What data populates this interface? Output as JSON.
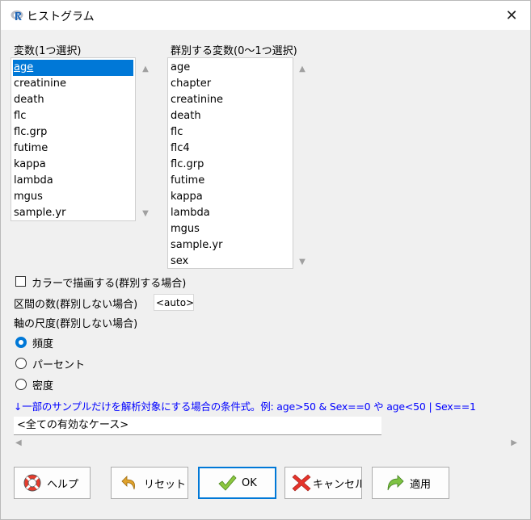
{
  "window": {
    "title": "ヒストグラム",
    "close_glyph": "✕"
  },
  "variables": {
    "label": "変数(1つ選択)",
    "items": [
      "age",
      "creatinine",
      "death",
      "flc",
      "flc.grp",
      "futime",
      "kappa",
      "lambda",
      "mgus",
      "sample.yr"
    ],
    "selected_index": 0
  },
  "groups": {
    "label": "群別する変数(0〜1つ選択)",
    "items": [
      "age",
      "chapter",
      "creatinine",
      "death",
      "flc",
      "flc4",
      "flc.grp",
      "futime",
      "kappa",
      "lambda",
      "mgus",
      "sample.yr",
      "sex"
    ]
  },
  "options": {
    "color_checkbox_label": "カラーで描画する(群別する場合)",
    "color_checked": false,
    "bins_label": "区間の数(群別しない場合)",
    "bins_value": "<auto>",
    "axis_label": "軸の尺度(群別しない場合)",
    "axis_options": [
      "頻度",
      "パーセント",
      "密度"
    ],
    "axis_selected": 0
  },
  "subset": {
    "hint": "↓一部のサンプルだけを解析対象にする場合の条件式。例: age>50 & Sex==0 や age<50 | Sex==1",
    "value": "<全ての有効なケース>"
  },
  "buttons": {
    "help": "ヘルプ",
    "reset": "リセット",
    "ok": "OK",
    "cancel": "キャンセル",
    "apply": "適用"
  },
  "colors": {
    "selection": "#0078d7",
    "hint_text": "#0000ff",
    "dialog_bg": "#f0f0f0"
  }
}
